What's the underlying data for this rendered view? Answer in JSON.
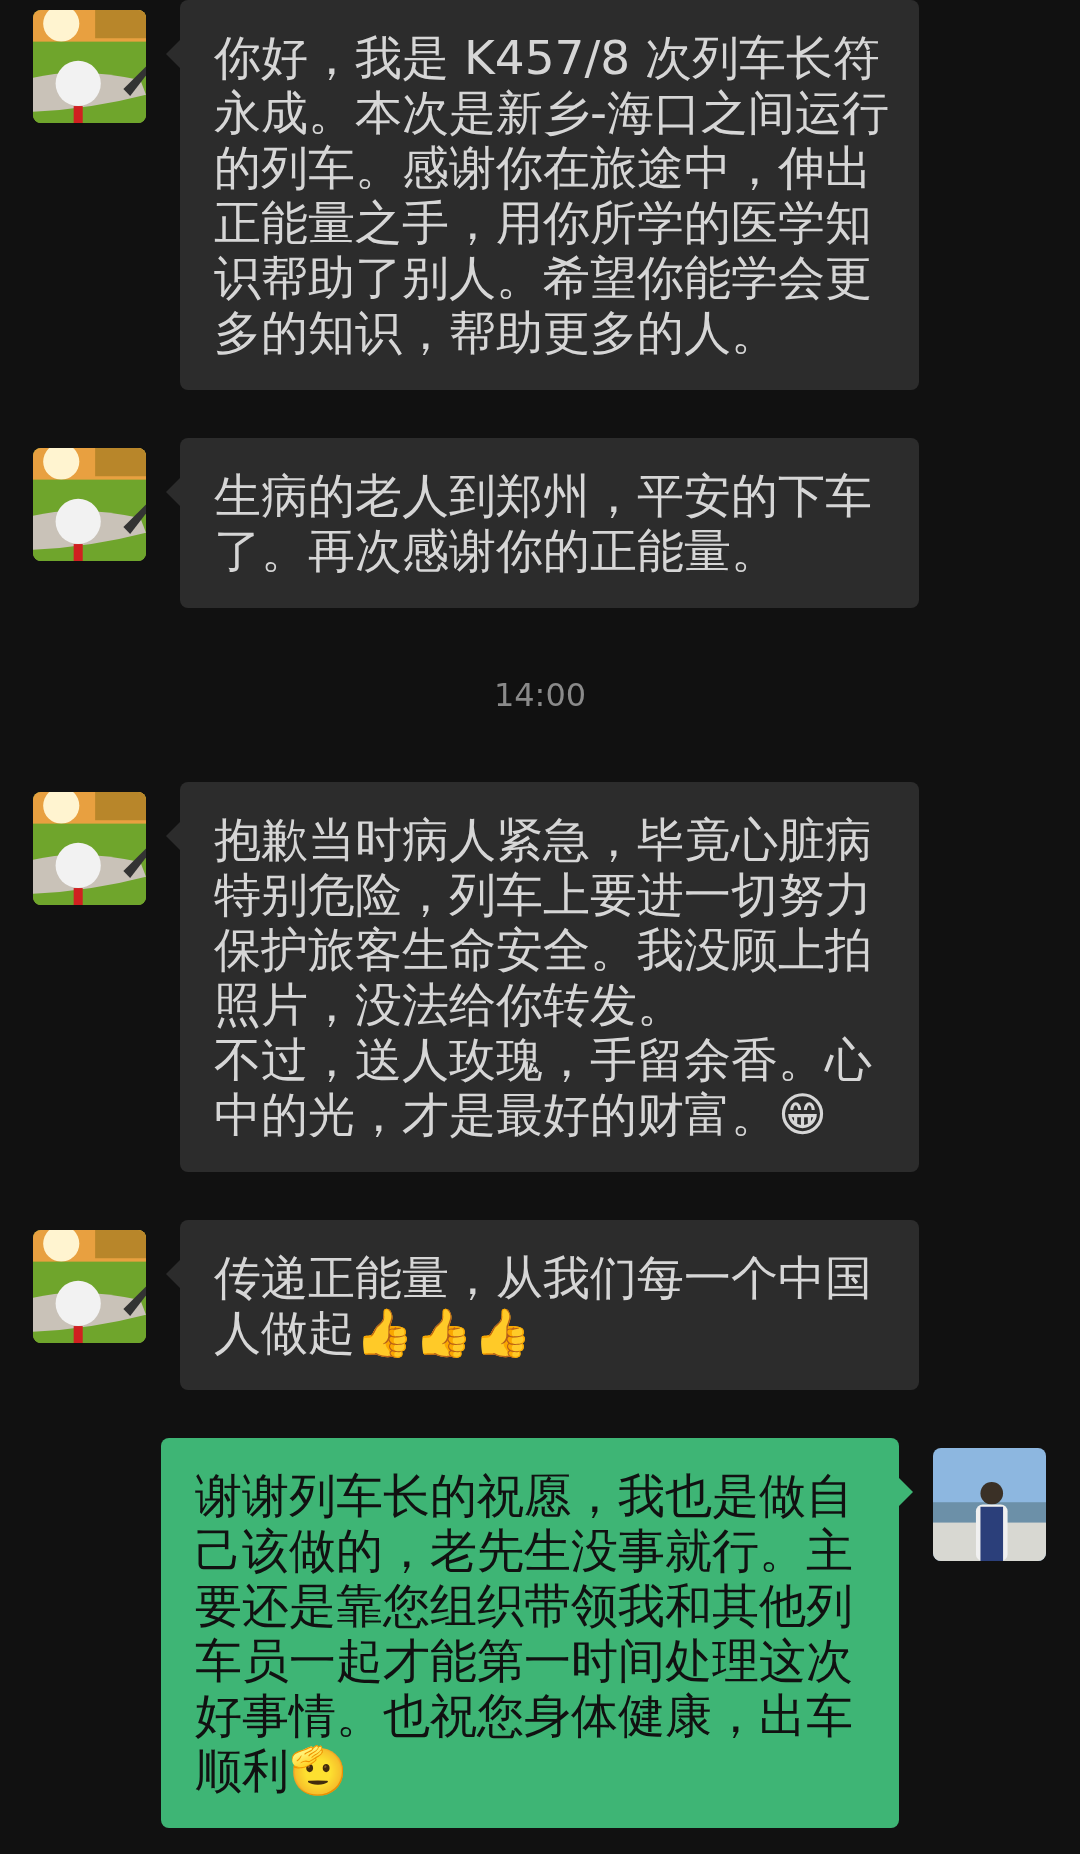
{
  "messages": [
    {
      "kind": "incoming",
      "lines": [
        "你好，我是 K457/8 次列车长符永成。本次是新乡-海口之间运行的列车。感谢你在旅途中，伸出正能量之手，用你所学的医学知识帮助了别人。希望你能学会更多的知识，帮助更多的人。"
      ]
    },
    {
      "kind": "incoming",
      "lines": [
        "生病的老人到郑州，平安的下车了。再次感谢你的正能量。"
      ]
    },
    {
      "kind": "time",
      "text": "14:00"
    },
    {
      "kind": "incoming",
      "lines": [
        "抱歉当时病人紧急，毕竟心脏病特别危险，列车上要进一切努力保护旅客生命安全。我没顾上拍照片，没法给你转发。",
        "不过，送人玫瑰，手留余香。心中的光，才是最好的财富。😁"
      ]
    },
    {
      "kind": "incoming",
      "lines": [
        "传递正能量，从我们每一个中国人做起👍👍👍"
      ]
    },
    {
      "kind": "outgoing",
      "lines": [
        "谢谢列车长的祝愿，我也是做自己该做的，老先生没事就行。主要还是靠您组织带领我和其他列车员一起才能第一时间处理这次好事情。也祝您身体健康，出车顺利🫡"
      ]
    }
  ]
}
